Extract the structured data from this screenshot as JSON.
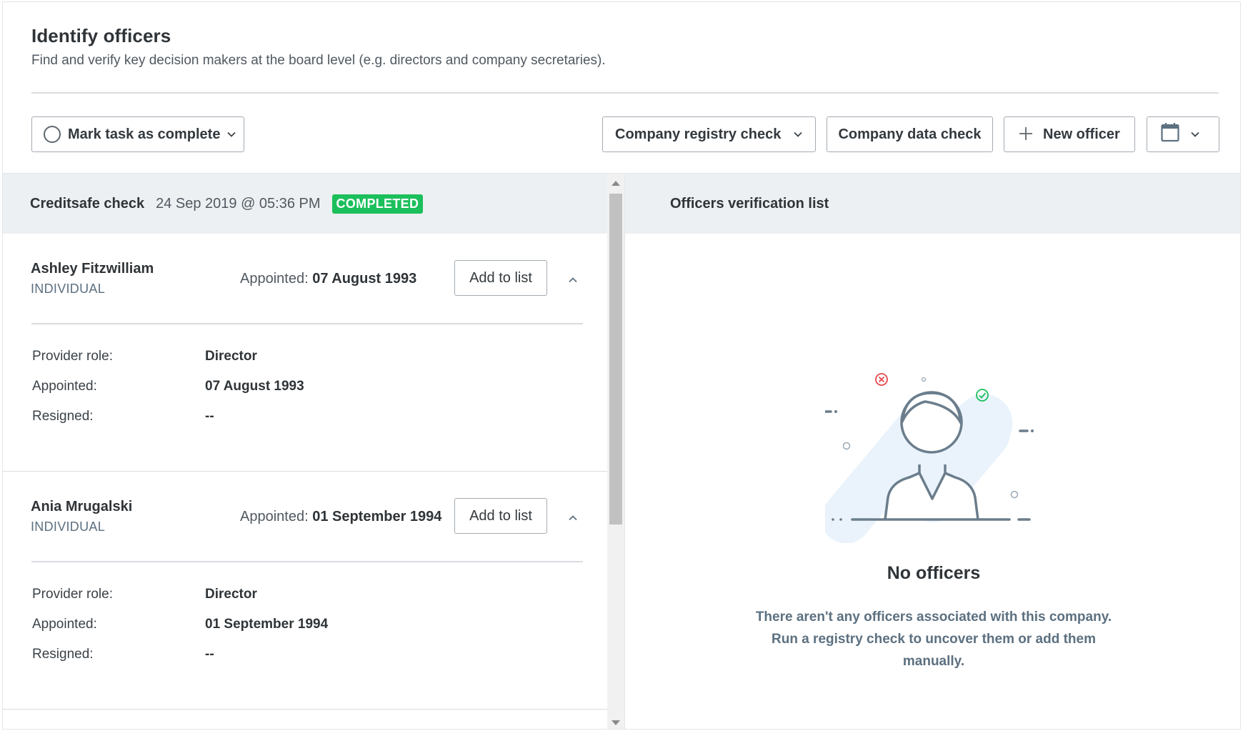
{
  "header": {
    "title": "Identify officers",
    "subtitle": "Find and verify key decision makers at the board level (e.g. directors and company secretaries)."
  },
  "toolbar": {
    "mark_complete_label": "Mark task as complete",
    "registry_check_label": "Company registry check",
    "data_check_label": "Company data check",
    "new_officer_label": "New officer"
  },
  "check": {
    "name": "Creditsafe check",
    "date": "24 Sep 2019 @ 05:36 PM",
    "status": "COMPLETED",
    "status_color": "#1bbf5b"
  },
  "officers": [
    {
      "name": "Ashley Fitzwilliam",
      "type": "INDIVIDUAL",
      "appointed_label": "Appointed:",
      "appointed_date": "07 August 1993",
      "add_label": "Add to list",
      "details": [
        {
          "label": "Provider role:",
          "value": "Director"
        },
        {
          "label": "Appointed:",
          "value": "07 August 1993"
        },
        {
          "label": "Resigned:",
          "value": "--"
        }
      ]
    },
    {
      "name": "Ania Mrugalski",
      "type": "INDIVIDUAL",
      "appointed_label": "Appointed:",
      "appointed_date": "01 September 1994",
      "add_label": "Add to list",
      "details": [
        {
          "label": "Provider role:",
          "value": "Director"
        },
        {
          "label": "Appointed:",
          "value": "01 September 1994"
        },
        {
          "label": "Resigned:",
          "value": "--"
        }
      ]
    }
  ],
  "verification": {
    "title": "Officers verification list",
    "empty_title": "No officers",
    "empty_text": "There aren't any officers associated with this company. Run a registry check to uncover them or add them manually."
  },
  "icons": {
    "status_circle": "circle-icon",
    "dropdown": "chevron-down-icon",
    "add": "plus-icon",
    "calendar": "calendar-icon",
    "collapse": "chevron-up-icon"
  }
}
